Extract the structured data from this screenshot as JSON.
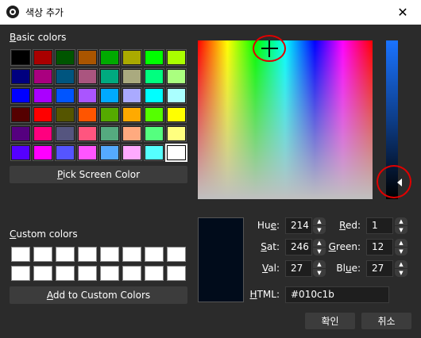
{
  "window": {
    "title": "색상 추가",
    "close_glyph": "✕"
  },
  "basic_colors": {
    "label": "Basic colors",
    "label_mnemonic": "B",
    "label_rest": "asic colors",
    "rows": [
      [
        "#000000",
        "#aa0000",
        "#005500",
        "#aa5500",
        "#00aa00",
        "#aaaa00",
        "#00ff00",
        "#aaff00"
      ],
      [
        "#00007f",
        "#aa007f",
        "#00557f",
        "#aa557f",
        "#00aa7f",
        "#aaaa7f",
        "#00ff7f",
        "#aaff7f"
      ],
      [
        "#0000ff",
        "#aa00ff",
        "#0055ff",
        "#aa55ff",
        "#00aaff",
        "#aaaaff",
        "#00ffff",
        "#aaffff"
      ],
      [
        "#550000",
        "#ff0000",
        "#555500",
        "#ff5500",
        "#55aa00",
        "#ffaa00",
        "#55ff00",
        "#ffff00"
      ],
      [
        "#55007f",
        "#ff007f",
        "#55557f",
        "#ff557f",
        "#55aa7f",
        "#ffaa7f",
        "#55ff7f",
        "#ffff7f"
      ],
      [
        "#5500ff",
        "#ff00ff",
        "#5555ff",
        "#ff55ff",
        "#55aaff",
        "#ffaaff",
        "#55ffff",
        "#ffffff"
      ]
    ],
    "selected": "#ffffff"
  },
  "pick_screen_button": {
    "label": "Pick Screen Color",
    "mnemonic": "P",
    "rest": "ick Screen Color"
  },
  "custom_colors": {
    "label": "Custom colors",
    "mnemonic": "C",
    "rest": "ustom colors",
    "rows": [
      [
        "#ffffff",
        "#ffffff",
        "#ffffff",
        "#ffffff",
        "#ffffff",
        "#ffffff",
        "#ffffff",
        "#ffffff"
      ],
      [
        "#ffffff",
        "#ffffff",
        "#ffffff",
        "#ffffff",
        "#ffffff",
        "#ffffff",
        "#ffffff",
        "#ffffff"
      ]
    ]
  },
  "add_custom_button": {
    "label": "Add to Custom Colors",
    "mnemonic": "A",
    "rest": "dd to Custom Colors"
  },
  "current_color": "#010c1b",
  "fields": {
    "hue": {
      "label": "Hue:",
      "pre": "Hu",
      "mnemonic": "e",
      "post": ":",
      "value": "214"
    },
    "sat": {
      "label": "Sat:",
      "pre": "",
      "mnemonic": "S",
      "post": "at:",
      "value": "246"
    },
    "val": {
      "label": "Val:",
      "pre": "",
      "mnemonic": "V",
      "post": "al:",
      "value": "27"
    },
    "red": {
      "label": "Red:",
      "pre": "",
      "mnemonic": "R",
      "post": "ed:",
      "value": "1"
    },
    "green": {
      "label": "Green:",
      "pre": "",
      "mnemonic": "G",
      "post": "reen:",
      "value": "12"
    },
    "blue": {
      "label": "Blue:",
      "pre": "Bl",
      "mnemonic": "u",
      "post": "e:",
      "value": "27"
    },
    "html": {
      "label": "HTML:",
      "pre": "",
      "mnemonic": "H",
      "post": "TML:",
      "value": "#010c1b"
    }
  },
  "ok_button": {
    "label": "확인"
  },
  "cancel_button": {
    "label": "취소"
  },
  "spin_up_glyph": "▲",
  "spin_down_glyph": "▼",
  "colors": {
    "background": "#2b2b2b",
    "button": "#3c3c3c",
    "input": "#1e1e1e",
    "annotation": "#e00000"
  }
}
